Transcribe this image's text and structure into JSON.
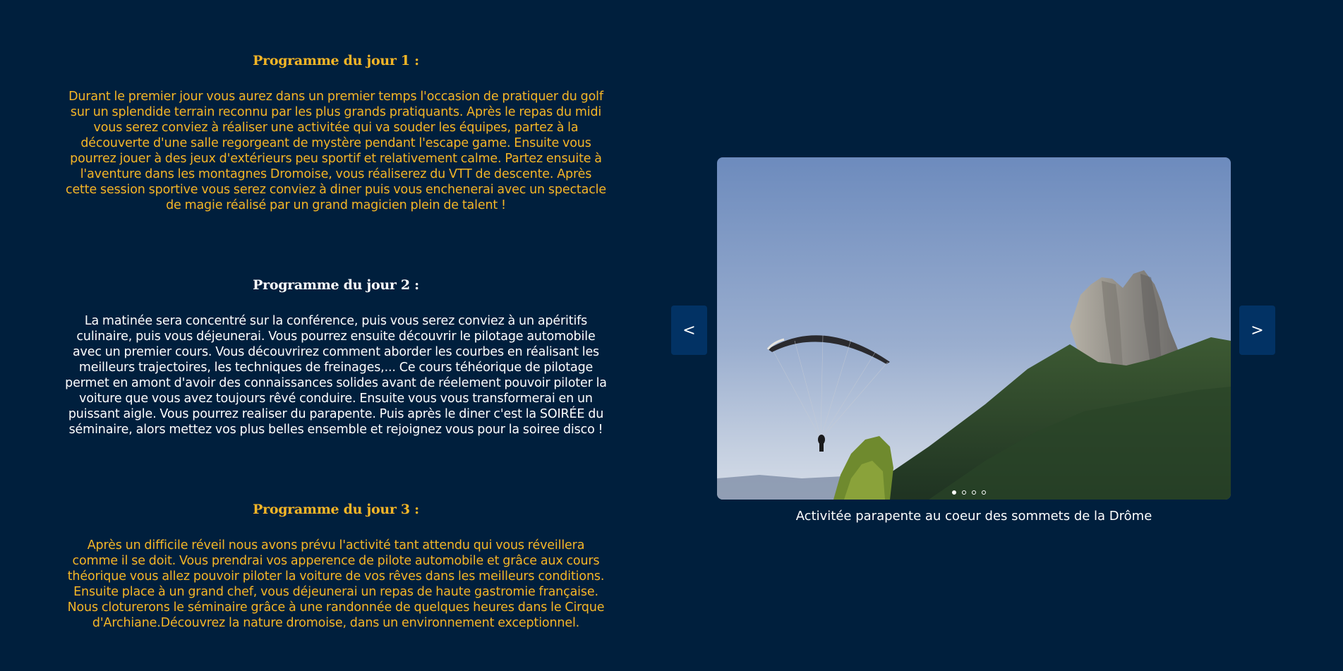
{
  "days": [
    {
      "title": "Programme du jour 1 :",
      "text": "Durant le premier jour vous aurez dans un premier temps l'occasion de pratiquer du golf sur un splendide terrain reconnu par les plus grands pratiquants. Après le repas du midi vous serez conviez à réaliser une activitée qui va souder les équipes, partez à la découverte d'une salle regorgeant de mystère pendant l'escape game. Ensuite vous pourrez jouer à des jeux d'extérieurs peu sportif et relativement calme. Partez ensuite à l'aventure dans les montagnes Dromoise, vous réaliserez du VTT de descente. Après cette session sportive vous serez conviez à diner puis vous enchenerai avec un spectacle de magie réalisé par un grand magicien plein de talent !",
      "color": "#f5b626"
    },
    {
      "title": "Programme du jour 2 :",
      "text": "La matinée sera concentré sur la conférence, puis vous serez conviez à un apéritifs culinaire, puis vous déjeunerai. Vous pourrez ensuite découvrir le pilotage automobile avec un premier cours. Vous découvrirez comment aborder les courbes en réalisant les meilleurs trajectoires, les techniques de freinages,... Ce cours téhéorique de pilotage permet en amont d'avoir des connaissances solides avant de réelement pouvoir piloter la voiture que vous avez toujours rêvé conduire. Ensuite vous vous transformerai en un puissant aigle. Vous pourrez realiser du parapente. Puis après le diner c'est la SOIRÉE du séminaire, alors mettez vos plus belles ensemble et rejoignez vous pour la soiree disco !",
      "color": "#ffffff"
    },
    {
      "title": "Programme du jour 3 :",
      "text": "Après un difficile réveil nous avons prévu l'activité tant attendu qui vous réveillera comme il se doit. Vous prendrai vos apperence de pilote automobile et grâce aux cours théorique vous allez pouvoir piloter la voiture de vos rêves dans les meilleurs conditions. Ensuite place à un grand chef, vous déjeunerai un repas de haute gastromie française. Nous cloturerons le séminaire grâce à une randonnée de quelques heures dans le Cirque d'Archiane.Découvrez la nature dromoise, dans un environnement exceptionnel.",
      "color": "#f5b626"
    }
  ],
  "carousel": {
    "prev_label": "<",
    "next_label": ">",
    "caption": "Activitée parapente au coeur des sommets de la Drôme",
    "slide_count": 4,
    "active_index": 0,
    "image_subject": "paraglider-over-mountain"
  },
  "colors": {
    "background": "#001f3d",
    "accent_yellow": "#f5b626",
    "button_bg": "#023264"
  }
}
